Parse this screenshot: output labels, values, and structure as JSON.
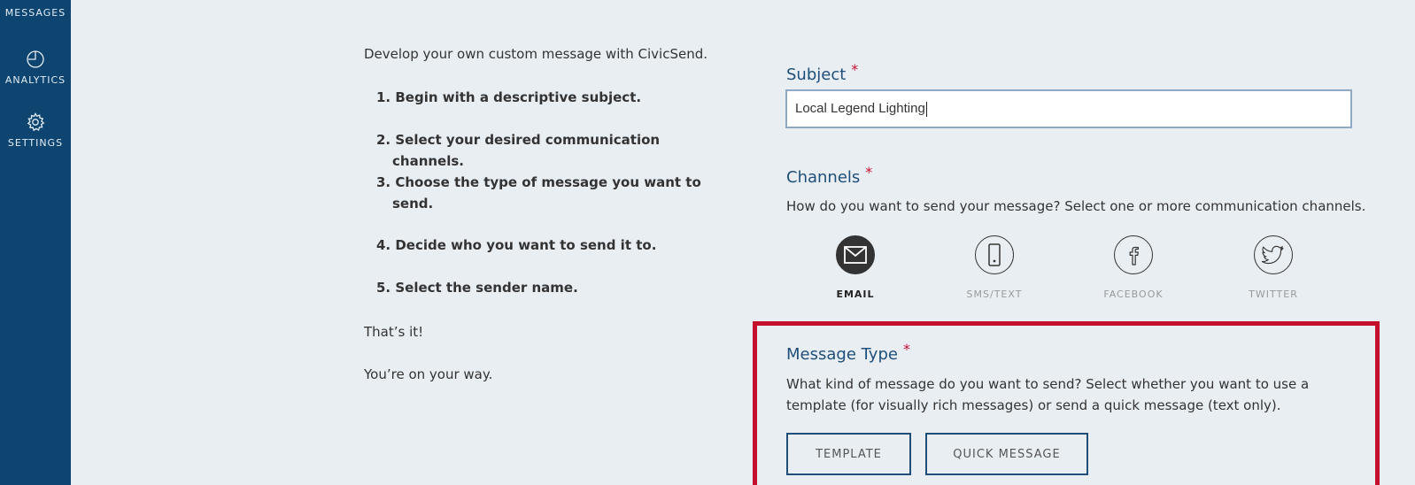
{
  "sidebar": {
    "items": [
      {
        "label": "MESSAGES",
        "icon": "messages-icon"
      },
      {
        "label": "ANALYTICS",
        "icon": "pie-chart-icon"
      },
      {
        "label": "SETTINGS",
        "icon": "gear-icon"
      }
    ]
  },
  "intro": {
    "heading": "Develop your own custom message with CivicSend.",
    "steps": [
      "1. Begin with a descriptive subject.",
      "2. Select your desired communication channels.",
      "3. Choose the type of message you want to send.",
      "4. Decide who you want to send it to.",
      "5. Select the sender name."
    ],
    "outro1": "That’s it!",
    "outro2": "You’re on your way."
  },
  "form": {
    "subject": {
      "label": "Subject",
      "required_mark": "*",
      "value": "Local Legend Lighting"
    },
    "channels": {
      "label": "Channels",
      "required_mark": "*",
      "description": "How do you want to send your message? Select one or more communication channels.",
      "options": [
        {
          "label": "EMAIL",
          "icon": "email-icon",
          "selected": true
        },
        {
          "label": "SMS/TEXT",
          "icon": "phone-icon",
          "selected": false
        },
        {
          "label": "FACEBOOK",
          "icon": "facebook-icon",
          "selected": false
        },
        {
          "label": "TWITTER",
          "icon": "twitter-icon",
          "selected": false
        }
      ]
    },
    "message_type": {
      "label": "Message Type",
      "required_mark": "*",
      "description_line1": "What kind of message do you want to send? Select whether you want to use a",
      "description_line2": "template (for visually rich messages) or send a quick message (text only).",
      "template_button": "TEMPLATE",
      "quick_button": "QUICK MESSAGE"
    }
  },
  "colors": {
    "sidebar_bg": "#0d4470",
    "page_bg": "#e9eef3",
    "label_blue": "#1f4e78",
    "required_red": "#c8102e",
    "highlight_red": "#c4102a"
  }
}
